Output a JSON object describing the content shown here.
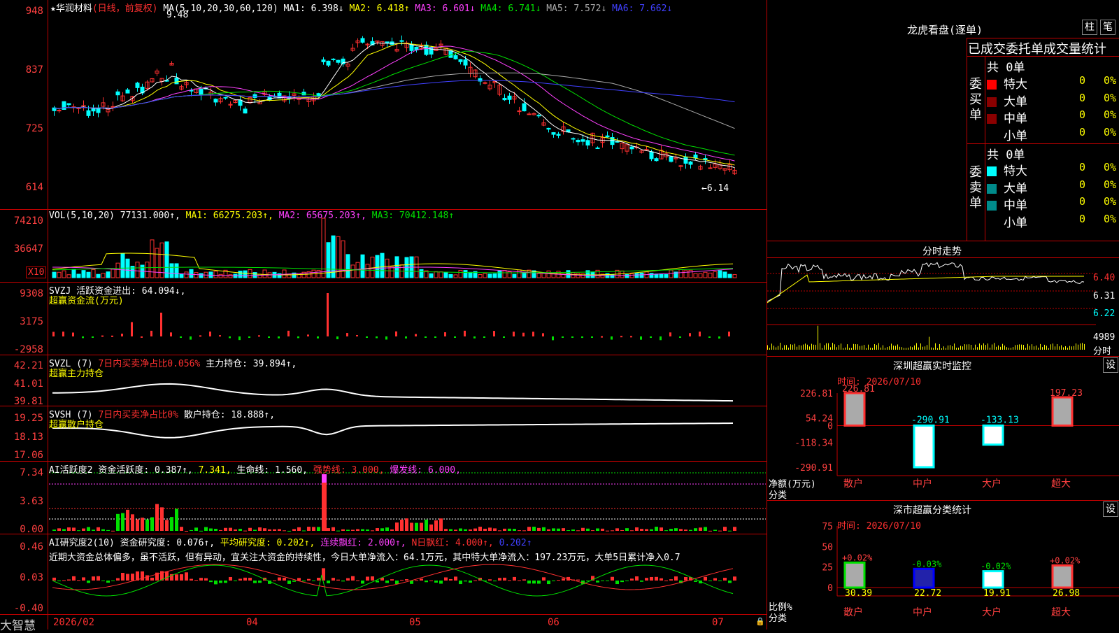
{
  "stock": {
    "star": "★",
    "name": "华润材料",
    "period": "(日线，前复权)"
  },
  "ma": {
    "label": "MA(5,10,20,30,60,120)",
    "ma1": "MA1: 6.398↓",
    "ma2": "MA2: 6.418↑",
    "ma3": "MA3: 6.601↓",
    "ma4": "MA4: 6.741↓",
    "ma5": "MA5: 7.572↓",
    "ma6": "MA6: 7.662↓"
  },
  "price": {
    "ticks": [
      "948",
      "837",
      "725",
      "614"
    ],
    "high_note": "9.48",
    "low_note": "←6.14"
  },
  "vol": {
    "label": "VOL(5,10,20)",
    "val": "77131.000↑,",
    "ma1": "MA1: 66275.203↑,",
    "ma2": "MA2: 65675.203↑,",
    "ma3": "MA3: 70412.148↑",
    "ticks": [
      "74210",
      "36647"
    ],
    "unit": "X10"
  },
  "svzj": {
    "label": "SVZJ 活跃资金进出: 64.094↓,",
    "sub": "超赢资金流(万元)",
    "ticks": [
      "9308",
      "3175",
      "-2958"
    ]
  },
  "svzl": {
    "label": "SVZL (7)",
    "pct": "7日内买卖净占比0.056%",
    "hold": "主力持仓: 39.894↑,",
    "sub": "超赢主力持仓",
    "ticks": [
      "42.21",
      "41.01",
      "39.81"
    ]
  },
  "svsh": {
    "label": "SVSH (7)",
    "pct": "7日内买卖净占比0%",
    "hold": "散户持仓: 18.888↑,",
    "sub": "超赢散户持仓",
    "ticks": [
      "19.25",
      "18.13",
      "17.06"
    ]
  },
  "ai2": {
    "label": "AI活跃度2",
    "act": "资金活跃度: 0.387↑,",
    "v2": "7.341,",
    "life": "生命线: 1.560,",
    "strong": "强势线: 3.000,",
    "burst": "爆发线: 6.000,",
    "ticks": [
      "7.34",
      "3.63",
      "0.00"
    ]
  },
  "ai_res": {
    "label": "AI研究度2(10)",
    "res": "资金研究度: 0.076↑,",
    "avg": "平均研究度: 0.202↑,",
    "cont": "连续飘红: 2.000↑,",
    "nday": "N日飘红: 4.000↑,",
    "last": "0.202↑",
    "ticks": [
      "0.46",
      "0.03",
      "-0.40"
    ],
    "comment": "近期大资金总体偏多，虽不活跃，但有异动，宜关注大资金的持续性，今日大单净流入：64.1万元，其中特大单净流入：197.23万元，大单5日累计净入0.7"
  },
  "xaxis": {
    "app": "大智慧",
    "dates": [
      "2026/02",
      "04",
      "05",
      "06",
      "07"
    ]
  },
  "dragon": {
    "title": "龙虎看盘(逐单)",
    "btn1": "柱",
    "btn2": "笔",
    "subtitle": "已成交委托单成交量统计",
    "buy_label": "委买单",
    "sell_label": "委卖单",
    "buy_total": "共 0单",
    "sell_total": "共 0单",
    "buy": [
      {
        "name": "特大",
        "n": "0",
        "p": "0%",
        "color": "#ff0000"
      },
      {
        "name": "大单",
        "n": "0",
        "p": "0%",
        "color": "#8b0000"
      },
      {
        "name": "中单",
        "n": "0",
        "p": "0%",
        "color": "#8b0000"
      },
      {
        "name": "小单",
        "n": "0",
        "p": "0%",
        "color": ""
      }
    ],
    "sell": [
      {
        "name": "特大",
        "n": "0",
        "p": "0%",
        "color": "#00ffff"
      },
      {
        "name": "大单",
        "n": "0",
        "p": "0%",
        "color": "#008b8b"
      },
      {
        "name": "中单",
        "n": "0",
        "p": "0%",
        "color": "#008b8b"
      },
      {
        "name": "小单",
        "n": "0",
        "p": "0%",
        "color": ""
      }
    ]
  },
  "fenshi": {
    "title": "分时走势",
    "ticks": [
      "6.40",
      "6.31",
      "6.22"
    ],
    "vol_tick": "4989",
    "vol_unit": "分时"
  },
  "sz_monitor": {
    "title": "深圳超赢实时监控",
    "btn": "设",
    "time": "时间: 2026/07/10",
    "ticks": [
      "226.81",
      "54.24",
      "0",
      "-118.34",
      "-290.91"
    ],
    "ylabel": "净额(万元)",
    "xlabel": "分类",
    "cats": [
      "散户",
      "中户",
      "大户",
      "超大"
    ],
    "values": [
      226.81,
      -290.91,
      -133.13,
      197.23
    ],
    "labels": [
      "226.81",
      "-290.91",
      "-133.13",
      "197.23"
    ]
  },
  "sz_class": {
    "title": "深市超赢分类统计",
    "btn": "设",
    "time": "时间: 2026/07/10",
    "ticks": [
      "75",
      "50",
      "25",
      "0"
    ],
    "ylabel": "比例%",
    "xlabel": "分类",
    "cats": [
      "散户",
      "中户",
      "大户",
      "超大"
    ],
    "values": [
      30.39,
      22.72,
      19.91,
      26.98
    ],
    "labels": [
      "30.39",
      "22.72",
      "19.91",
      "26.98"
    ],
    "chg": [
      "+0.02%",
      "-0.03%",
      "-0.02%",
      "+0.02%"
    ]
  },
  "chart_data": [
    {
      "type": "bar",
      "title": "深圳超赢实时监控",
      "categories": [
        "散户",
        "中户",
        "大户",
        "超大"
      ],
      "values": [
        226.81,
        -290.91,
        -133.13,
        197.23
      ],
      "ylabel": "净额(万元)",
      "ylim": [
        -290.91,
        226.81
      ]
    },
    {
      "type": "bar",
      "title": "深市超赢分类统计",
      "categories": [
        "散户",
        "中户",
        "大户",
        "超大"
      ],
      "values": [
        30.39,
        22.72,
        19.91,
        26.98
      ],
      "ylabel": "比例%",
      "ylim": [
        0,
        75
      ]
    }
  ]
}
